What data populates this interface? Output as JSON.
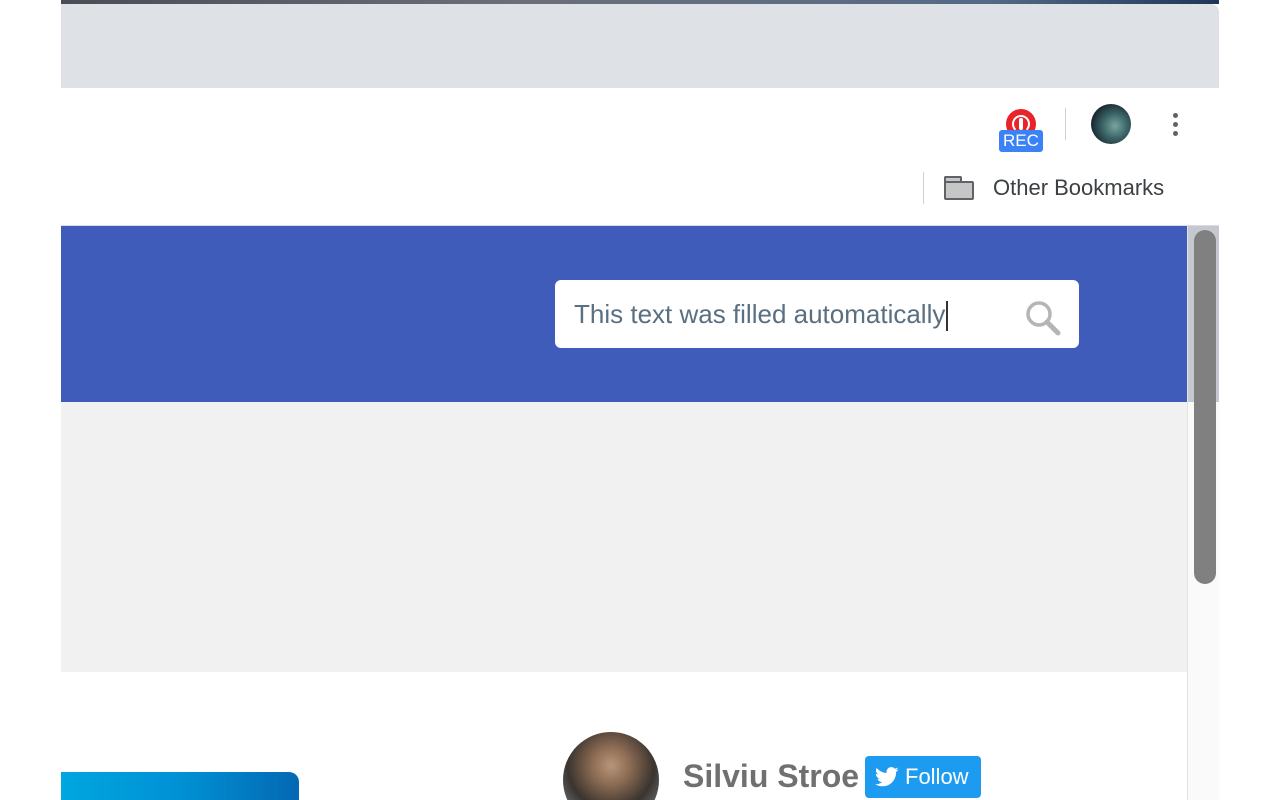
{
  "extensions": {
    "recorder": {
      "badge": "REC"
    }
  },
  "bookmarks_bar": {
    "other_bookmarks_label": "Other Bookmarks"
  },
  "page": {
    "search": {
      "value": "This text was filled automatically"
    },
    "author": {
      "name": "Silviu Stroe",
      "follow_label": "Follow"
    }
  },
  "colors": {
    "hero_blue": "#405cbb",
    "gray_band": "#f1f1f2",
    "follow_blue": "#1d9bf0",
    "rec_red": "#e8232a",
    "rec_badge_blue": "#3b82f6"
  },
  "scrollbar": {
    "position_fraction": 0.0
  }
}
